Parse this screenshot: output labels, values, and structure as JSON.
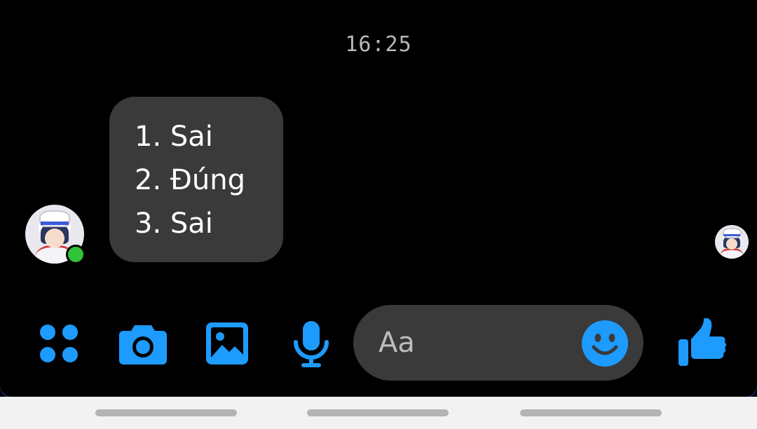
{
  "conversation": {
    "timestamp": "16:25",
    "message": {
      "lines": [
        "1. Sai",
        "2. Đúng",
        "3. Sai"
      ]
    },
    "sender_online": true
  },
  "composer": {
    "placeholder": "Aa",
    "icons": [
      "apps-grid-icon",
      "camera-icon",
      "gallery-icon",
      "microphone-icon",
      "emoji-icon",
      "thumbs-up-icon"
    ]
  },
  "colors": {
    "accent": "#1e9bff",
    "bubble": "#3a3a3b",
    "background": "#000000",
    "online": "#31c439"
  }
}
